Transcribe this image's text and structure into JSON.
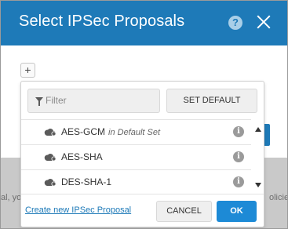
{
  "dialog": {
    "title": "Select IPSec Proposals",
    "help_label": "?",
    "add_label": "+"
  },
  "background": {
    "left_fragment": "al, yo",
    "right_fragment": "olicies"
  },
  "popover": {
    "filter": {
      "placeholder": "Filter",
      "value": ""
    },
    "set_default_label": "SET DEFAULT",
    "items": [
      {
        "label": "AES-GCM",
        "note": "in Default Set",
        "info": "i",
        "icon": "cloud-icon"
      },
      {
        "label": "AES-SHA",
        "note": "",
        "info": "i",
        "icon": "cloud-icon"
      },
      {
        "label": "DES-SHA-1",
        "note": "",
        "info": "i",
        "icon": "cloud-icon"
      }
    ],
    "create_link": "Create new IPSec Proposal",
    "cancel_label": "CANCEL",
    "ok_label": "OK"
  },
  "colors": {
    "header": "#1e7ab8",
    "primary_button": "#1d8ad6",
    "link": "#1e7ab8"
  }
}
